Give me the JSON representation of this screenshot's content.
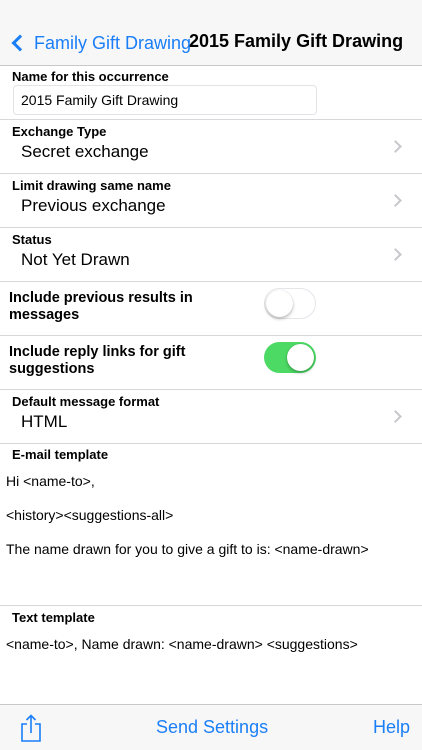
{
  "nav": {
    "back_label": "Family Gift Drawing",
    "title": "2015 Family Gift Drawing"
  },
  "occurrence": {
    "label": "Name for this occurrence",
    "value": "2015 Family Gift Drawing"
  },
  "exchange_type": {
    "label": "Exchange Type",
    "value": "Secret exchange"
  },
  "limit_drawing": {
    "label": "Limit drawing same name",
    "value": "Previous exchange"
  },
  "status": {
    "label": "Status",
    "value": "Not Yet Drawn"
  },
  "include_previous": {
    "label": "Include previous results in messages",
    "on": false
  },
  "include_reply_links": {
    "label": "Include reply links for gift suggestions",
    "on": true
  },
  "message_format": {
    "label": "Default message format",
    "value": "HTML"
  },
  "email_template": {
    "label": "E-mail template",
    "lines": [
      "Hi <name-to>,",
      "<history><suggestions-all>",
      "The name drawn for you to give a gift to is: <name-drawn>"
    ]
  },
  "text_template": {
    "label": "Text template",
    "lines": [
      "<name-to>, Name drawn: <name-drawn> <suggestions>"
    ]
  },
  "toolbar": {
    "share_icon": "share-icon",
    "send_settings_label": "Send Settings",
    "help_label": "Help"
  },
  "colors": {
    "accent": "#1a7ff7",
    "switch_on": "#4cd964"
  }
}
